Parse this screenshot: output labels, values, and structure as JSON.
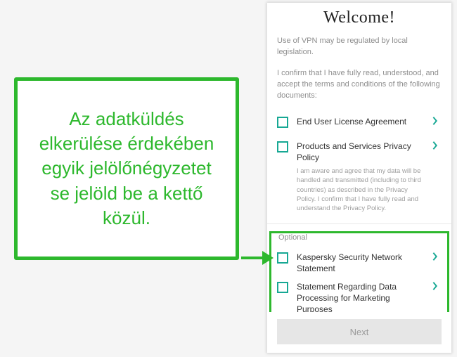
{
  "callout": {
    "text": "Az adatküldés elkerülése érdekében egyik jelölőnégyzetet se jelöld be a kettő közül."
  },
  "welcome": {
    "title": "Welcome!",
    "regulation_note": "Use of VPN may be regulated by local legislation.",
    "confirm_text": "I confirm that I have fully read, understood, and accept the terms and conditions of the following documents:",
    "required": [
      {
        "label": "End User License Agreement"
      },
      {
        "label": "Products and Services Privacy Policy",
        "desc": "I am aware and agree that my data will be handled and transmitted (including to third countries) as described in the Privacy Policy. I confirm that I have fully read and understand the Privacy Policy."
      }
    ],
    "optional_label": "Optional",
    "optional": [
      {
        "label": "Kaspersky Security Network Statement"
      },
      {
        "label": "Statement Regarding Data Processing for Marketing Purposes"
      }
    ],
    "next_label": "Next"
  }
}
